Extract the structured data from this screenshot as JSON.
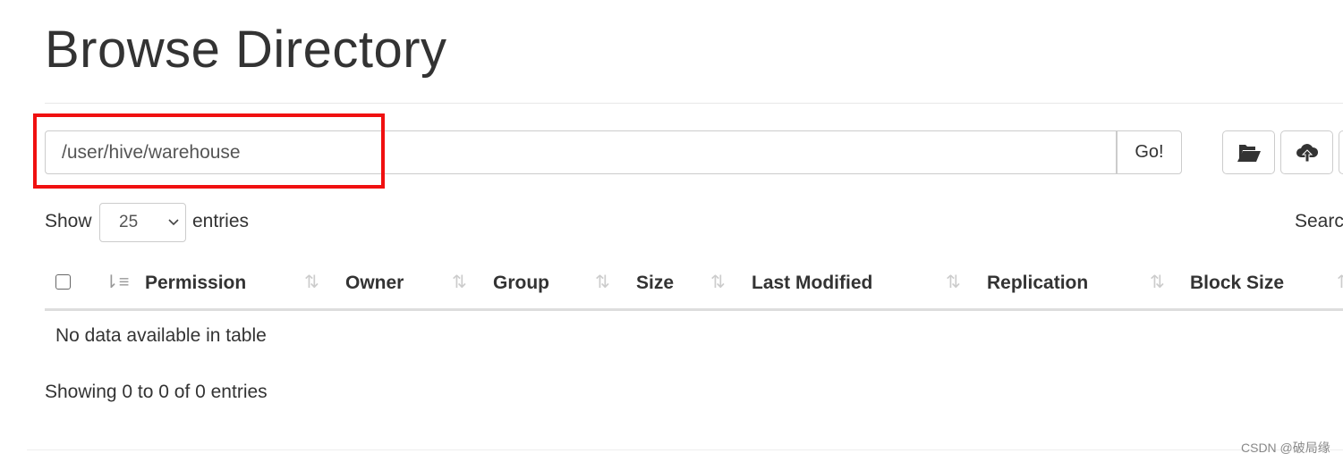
{
  "page_title": "Browse Directory",
  "path_input": {
    "value": "/user/hive/warehouse"
  },
  "go_label": "Go!",
  "toolbar": {
    "icons": [
      "folder-open-icon",
      "cloud-upload-icon"
    ]
  },
  "length": {
    "show": "Show",
    "value": "25",
    "entries": "entries"
  },
  "search_label": "Searc",
  "table": {
    "columns": [
      "Permission",
      "Owner",
      "Group",
      "Size",
      "Last Modified",
      "Replication",
      "Block Size"
    ],
    "empty": "No data available in table"
  },
  "info": "Showing 0 to 0 of 0 entries",
  "watermark": "CSDN @破局缘",
  "colors": {
    "highlight": "#f01010"
  }
}
